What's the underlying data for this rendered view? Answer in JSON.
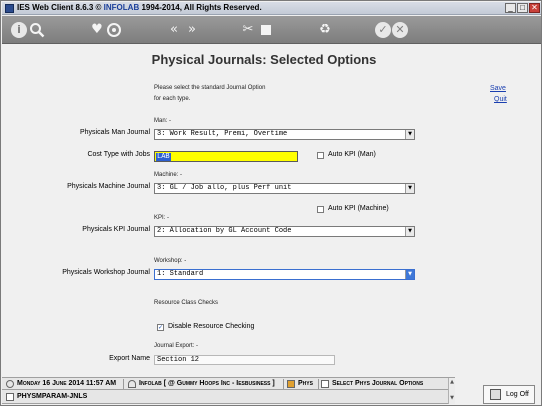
{
  "window": {
    "title_prefix": "IES Web Client 8.6.3 © ",
    "title_brand": "INFOLAB",
    "title_suffix": " 1994-2014, All Rights Reserved.",
    "minimize": "_",
    "restore": "□",
    "close": "✕"
  },
  "toolbar": {
    "icons": [
      "info-icon",
      "search-icon",
      "favorite-icon",
      "refresh-icon",
      "rewind-icon",
      "forward-icon",
      "tools-icon",
      "stop-icon",
      "recycle-icon",
      "ok-icon",
      "cancel-icon"
    ]
  },
  "page": {
    "title": "Physical Journals: Selected Options",
    "instruction_line1": "Please select the standard Journal Option",
    "instruction_line2": "for each type.",
    "save_link": "Save",
    "quit_link": "Quit"
  },
  "man": {
    "section": "Man: -",
    "journal_label": "Physicals Man Journal",
    "journal_value": "3: Work Result, Premi, Overtime",
    "cost_type_label": "Cost Type with Jobs",
    "cost_type_value": "LAB",
    "auto_kpi_label": "Auto KPI (Man)",
    "auto_kpi_checked": false
  },
  "machine": {
    "section": "Machine: -",
    "journal_label": "Physicals Machine Journal",
    "journal_value": "3: GL / Job allo, plus Perf unit",
    "auto_kpi_label": "Auto KPI (Machine)",
    "auto_kpi_checked": false
  },
  "kpi": {
    "section": "KPI: -",
    "journal_label": "Physicals KPI Journal",
    "journal_value": "2: Allocation by GL Account Code"
  },
  "workshop": {
    "section": "Workshop: -",
    "journal_label": "Physicals Workshop Journal",
    "journal_value": "1: Standard"
  },
  "resource": {
    "section": "Resource Class Checks",
    "disable_label": "Disable Resource Checking",
    "disable_checked": true
  },
  "export": {
    "section": "Journal Export: -",
    "name_label": "Export Name",
    "name_value": "Section 12"
  },
  "statusbar": {
    "date": "Monday 16 June 2014 11:57 AM",
    "company": "Infolab [ @ Gummy Hoops Inc - Iesbusiness ]",
    "module": "Phys",
    "screen": "Select Phys Journal Options",
    "program": "PHYSMPARAM-JNLS",
    "logoff": "Log Off"
  },
  "colors": {
    "toolbar": "#8a8a8a",
    "input_highlight": "#ffff00",
    "link": "#1a3fb0"
  }
}
